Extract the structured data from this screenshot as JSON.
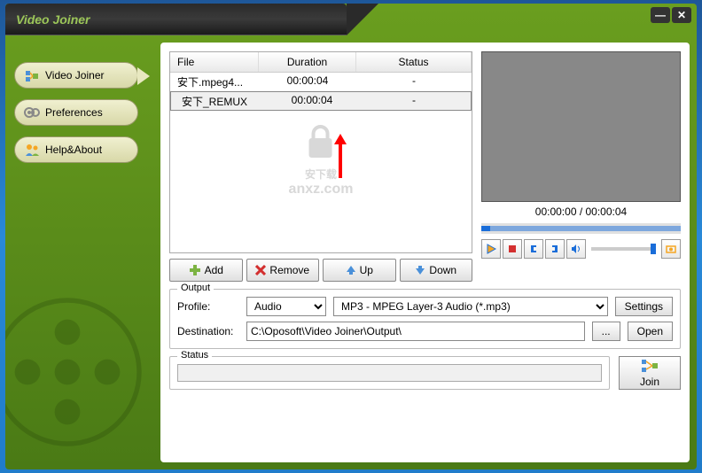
{
  "title": "Video Joiner",
  "nav": {
    "joiner": "Video Joiner",
    "prefs": "Preferences",
    "help": "Help&About"
  },
  "table": {
    "headers": {
      "file": "File",
      "duration": "Duration",
      "status": "Status"
    },
    "rows": [
      {
        "file": "安下.mpeg4...",
        "duration": "00:00:04",
        "status": "-"
      },
      {
        "file": "安下_REMUX",
        "duration": "00:00:04",
        "status": "-"
      }
    ]
  },
  "buttons": {
    "add": "Add",
    "remove": "Remove",
    "up": "Up",
    "down": "Down",
    "settings": "Settings",
    "browse": "...",
    "open": "Open",
    "join": "Join"
  },
  "preview": {
    "time": "00:00:00 / 00:00:04"
  },
  "output": {
    "group": "Output",
    "profile_label": "Profile:",
    "profile_category": "Audio",
    "profile_format": "MP3 - MPEG Layer-3 Audio (*.mp3)",
    "dest_label": "Destination:",
    "dest_path": "C:\\Oposoft\\Video Joiner\\Output\\"
  },
  "status": {
    "group": "Status"
  },
  "watermark": {
    "line1": "安下载",
    "line2": "anxz.com"
  }
}
